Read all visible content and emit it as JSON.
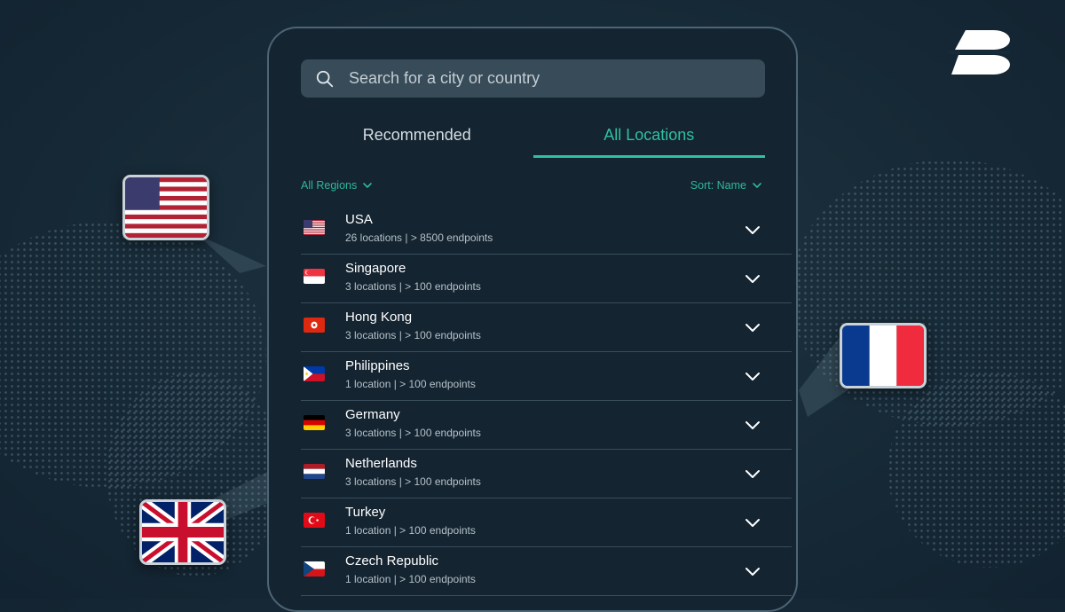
{
  "search": {
    "placeholder": "Search for a city or country",
    "icon": "search-icon"
  },
  "tabs": [
    {
      "label": "Recommended",
      "active": false
    },
    {
      "label": "All Locations",
      "active": true
    }
  ],
  "filters": {
    "region_label": "All Regions",
    "sort_label": "Sort: Name"
  },
  "locations": [
    {
      "name": "USA",
      "details": "26 locations | > 8500 endpoints",
      "flag": "us-flag"
    },
    {
      "name": "Singapore",
      "details": "3 locations | > 100 endpoints",
      "flag": "sg-flag"
    },
    {
      "name": "Hong Kong",
      "details": "3 locations | > 100 endpoints",
      "flag": "hk-flag"
    },
    {
      "name": "Philippines",
      "details": "1 location | > 100 endpoints",
      "flag": "ph-flag"
    },
    {
      "name": "Germany",
      "details": "3 locations | > 100 endpoints",
      "flag": "de-flag"
    },
    {
      "name": "Netherlands",
      "details": "3 locations | > 100 endpoints",
      "flag": "nl-flag"
    },
    {
      "name": "Turkey",
      "details": "1 location | > 100 endpoints",
      "flag": "tr-flag"
    },
    {
      "name": "Czech Republic",
      "details": "1 location | > 100 endpoints",
      "flag": "cz-flag"
    }
  ],
  "colors": {
    "accent": "#2fc1a2",
    "background": "#172a37",
    "panel": "#142431",
    "search_bg": "#384b58"
  }
}
